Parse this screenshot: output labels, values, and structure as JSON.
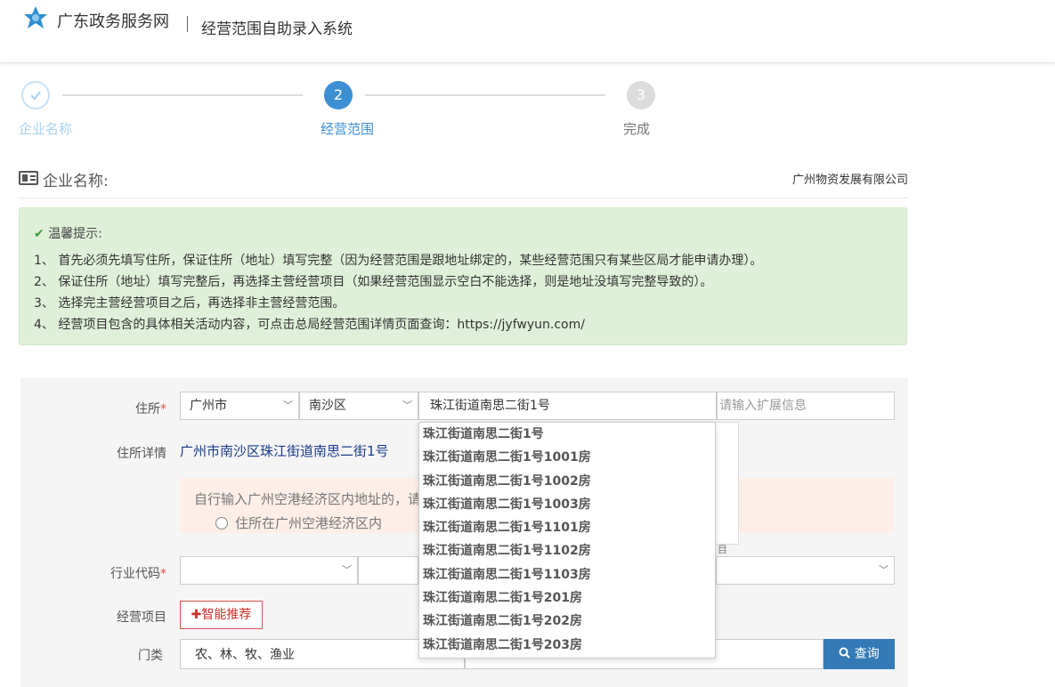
{
  "header": {
    "site_name": "广东政务服务网",
    "system_name": "经营范围自助录入系统",
    "brand_color": "#2f8fd1"
  },
  "steps": [
    {
      "number": "",
      "label": "企业名称",
      "status": "done"
    },
    {
      "number": "2",
      "label": "经营范围",
      "status": "active"
    },
    {
      "number": "3",
      "label": "完成",
      "status": "pending"
    }
  ],
  "company": {
    "label": "企业名称:",
    "value": "广州物资发展有限公司"
  },
  "tips": {
    "title": "温馨提示:",
    "items": [
      "1、 首先必须先填写住所，保证住所（地址）填写完整（因为经营范围是跟地址绑定的，某些经营范围只有某些区局才能申请办理）。",
      "2、 保证住所（地址）填写完整后，再选择主营经营项目（如果经营范围显示空白不能选择，则是地址没填写完整导致的）。",
      "3、 选择完主营经营项目之后，再选择非主营经营范围。",
      "4、 经营项目包含的具体相关活动内容，可点击总局经营范围详情页面查询：https://jyfwyun.com/"
    ]
  },
  "form": {
    "address_label": "住所",
    "required_mark": "*",
    "city": "广州市",
    "district": "南沙区",
    "street_value": "珠江街道南思二街1号",
    "ext_placeholder": "请输入扩展信息",
    "address_detail_label": "住所详情",
    "address_detail_value": "广州市南沙区珠江街道南思二街1号",
    "warn_text": "自行输入广州空港经济区内地址的，请",
    "radio_label": "住所在广州空港经济区内",
    "ghost_char": "目",
    "industry_label": "行业代码",
    "business_label": "经营项目",
    "smart_button": "智能推荐",
    "category_label": "门类",
    "category_value": "农、林、牧、渔业",
    "search_button": "查询"
  },
  "dropdown_options": [
    "珠江街道南思二街1号",
    "珠江街道南思二街1号1001房",
    "珠江街道南思二街1号1002房",
    "珠江街道南思二街1号1003房",
    "珠江街道南思二街1号1101房",
    "珠江街道南思二街1号1102房",
    "珠江街道南思二街1号1103房",
    "珠江街道南思二街1号201房",
    "珠江街道南思二街1号202房",
    "珠江街道南思二街1号203房"
  ]
}
